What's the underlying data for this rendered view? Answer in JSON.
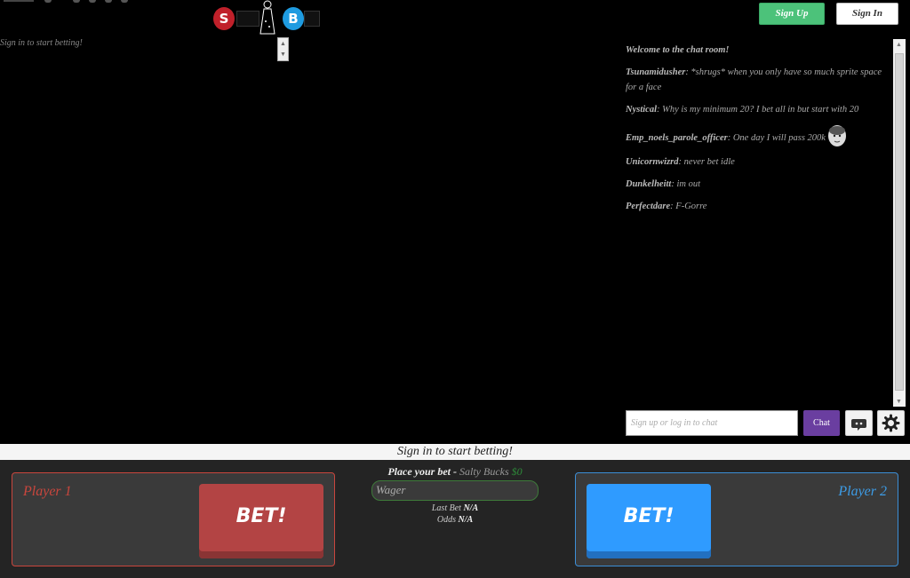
{
  "header": {
    "logo_left_letter": "S",
    "logo_right_letter": "B",
    "signup_label": "Sign Up",
    "signin_label": "Sign In"
  },
  "stream": {
    "signin_note": "Sign in to start betting!"
  },
  "chat": {
    "welcome": "Welcome to the chat room!",
    "messages": [
      {
        "user": "Tsunamidusher",
        "text": ": *shrugs* when you only have so much sprite space for a face"
      },
      {
        "user": "Nystical",
        "text": ": Why is my minimum 20? I bet all in but start with 20"
      },
      {
        "user": "Emp_noels_parole_officer",
        "text": ": One day I will pass 200k"
      },
      {
        "user": "Unicornwizrd",
        "text": ": never bet idle"
      },
      {
        "user": "Dunkelheitt",
        "text": ": im out"
      },
      {
        "user": "Perfectdare",
        "text": ": F-Gorre"
      }
    ],
    "input_placeholder": "Sign up or log in to chat",
    "chat_button": "Chat",
    "icons": [
      "emote-icon",
      "gear-icon"
    ]
  },
  "betting": {
    "status": "Sign in to start betting!",
    "place_bet": "Place your bet - ",
    "currency_label": "Salty Bucks",
    "balance": "$0",
    "wager_placeholder": "Wager",
    "last_bet_label": "Last Bet ",
    "last_bet_value": "N/A",
    "odds_label": "Odds ",
    "odds_value": "N/A",
    "player1": {
      "name": "Player 1",
      "button": "BET!",
      "color": "#c9463d"
    },
    "player2": {
      "name": "Player 2",
      "button": "BET!",
      "color": "#3d9ce6"
    }
  },
  "colors": {
    "signup_green": "#4cc27a",
    "chat_purple": "#6a3ea0",
    "red_accent": "#b34444",
    "blue_accent": "#2f9bff"
  }
}
